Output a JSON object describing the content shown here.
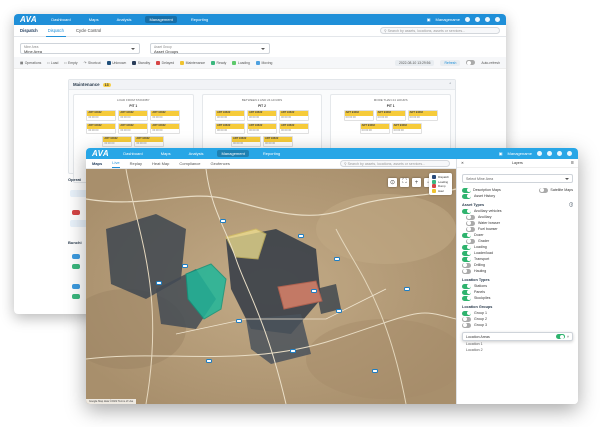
{
  "brand": "AVA",
  "back": {
    "nav": [
      "Dashboard",
      "Maps",
      "Analysis",
      "Management",
      "Reporting"
    ],
    "nav_active": 3,
    "user": "Managename",
    "page": "Dispatch",
    "tabs": [
      "Dispatch",
      "Cycle Control"
    ],
    "search_placeholder": "Search by assets, locations, assets or services...",
    "sel1": {
      "label": "Mine Area",
      "value": "Mine Area"
    },
    "sel2": {
      "label": "Asset Group",
      "value": "Asset Groups"
    },
    "legend_left": [
      "Operations",
      "Load",
      "Empty",
      "Shortcut"
    ],
    "legend_items": [
      {
        "label": "Unknown",
        "color": "#1f4f7a"
      },
      {
        "label": "Standby",
        "color": "#2a3d5a"
      },
      {
        "label": "Delayed",
        "color": "#d64545"
      },
      {
        "label": "Maintenance",
        "color": "#f0c330"
      },
      {
        "label": "Ready",
        "color": "#3bb77e"
      },
      {
        "label": "Loading",
        "color": "#5ec96b"
      },
      {
        "label": "Moving",
        "color": "#4ea1e0"
      }
    ],
    "date": "2022-08-10 13:29:56",
    "refresh": "Refresh",
    "auto_toggle": "Auto-refresh",
    "maint_title": "Maintenance",
    "maint_count": "13",
    "columns": [
      {
        "title": "LOAD FROM STANDBY",
        "pit": "PIT 1",
        "chips": [
          {
            "id": "ART 94632",
            "time": "00:00:00"
          },
          {
            "id": "ART 94632",
            "time": "00:00:00"
          },
          {
            "id": "ART 94632",
            "time": "00:00:00"
          },
          {
            "id": "ART 94632",
            "time": "00:00:00"
          },
          {
            "id": "ART 94632",
            "time": "00:00:00"
          },
          {
            "id": "ART 94632",
            "time": "00:00:00"
          },
          {
            "id": "ART 94632",
            "time": "00:00:00"
          },
          {
            "id": "ART 94632",
            "time": "00:00:00"
          }
        ],
        "pit2": "PIT 1",
        "chips2": [
          {
            "id": "ART 94632",
            "time": "00:00:00"
          },
          {
            "id": "ART 94632",
            "time": "00:00:00"
          },
          {
            "id": "ART 94632",
            "time": "00:00:00"
          },
          {
            "id": "ART 94632",
            "time": "00:00:00"
          }
        ]
      },
      {
        "title": "BETWEEN 2 AND 24 HOURS",
        "pit": "PIT 2",
        "chips": [
          {
            "id": "ART 94632",
            "time": "00:00:00"
          },
          {
            "id": "ART 94632",
            "time": "00:00:00"
          },
          {
            "id": "ART 94632",
            "time": "00:00:00"
          },
          {
            "id": "ART 94632",
            "time": "00:00:00"
          },
          {
            "id": "ART 94632",
            "time": "00:00:00"
          },
          {
            "id": "ART 94632",
            "time": "00:00:00"
          },
          {
            "id": "ART 94632",
            "time": "00:00:00"
          },
          {
            "id": "ART 94632",
            "time": "00:00:00"
          }
        ]
      },
      {
        "title": "MORE THAN 24 HOURS",
        "pit": "PIT 1",
        "chips": [
          {
            "id": "ART 94632",
            "time": "00:00:00"
          },
          {
            "id": "ART 94632",
            "time": "00:00:00"
          },
          {
            "id": "ART 94632",
            "time": "00:00:00"
          },
          {
            "id": "ART 94632",
            "time": "00:00:00"
          },
          {
            "id": "ART 94632",
            "time": "00:00:00"
          }
        ]
      }
    ],
    "left_sections": [
      "Operat",
      "Bunchi"
    ]
  },
  "front": {
    "nav": [
      "Dashboard",
      "Maps",
      "Analysis",
      "Management",
      "Reporting"
    ],
    "nav_active": 3,
    "user": "Managename",
    "tabs": [
      "Maps",
      "Live",
      "Replay",
      "Heat Map",
      "Compliance",
      "Geofences"
    ],
    "tabs_active": 1,
    "search_placeholder": "Search by assets, locations, assets or services...",
    "map_legend": [
      {
        "label": "Dispatch",
        "color": "#2a4a7a"
      },
      {
        "label": "Loading",
        "color": "#3bb77e"
      },
      {
        "label": "Dump",
        "color": "#d64545"
      },
      {
        "label": "Haul",
        "color": "#f0c330"
      }
    ],
    "map_footer": "Google  Map data ©2022  Terms of Use",
    "panel": {
      "title": "Layers",
      "area_placeholder": "Select Mine Area",
      "desc_toggle": "Description Maps",
      "satellite_toggle": "Satellite Maps",
      "asset_history": "Asset History",
      "asset_types_title": "Asset Types",
      "asset_types": [
        {
          "label": "Ancillary vehicles",
          "on": true,
          "sub": false
        },
        {
          "label": "Ancillary",
          "on": false,
          "sub": true
        },
        {
          "label": "Water bowser",
          "on": false,
          "sub": true
        },
        {
          "label": "Fuel bowser",
          "on": false,
          "sub": true
        },
        {
          "label": "Dozer",
          "on": true,
          "sub": false
        },
        {
          "label": "Grader",
          "on": false,
          "sub": true
        },
        {
          "label": "Loading",
          "on": true,
          "sub": false
        },
        {
          "label": "Loader/load",
          "on": true,
          "sub": false
        },
        {
          "label": "Transport",
          "on": true,
          "sub": false
        },
        {
          "label": "Drilling",
          "on": false,
          "sub": false
        },
        {
          "label": "Hauling",
          "on": false,
          "sub": false
        }
      ],
      "location_types_title": "Location Types",
      "location_types": [
        {
          "label": "Stations",
          "on": true
        },
        {
          "label": "Panels",
          "on": true
        },
        {
          "label": "Stockpiles",
          "on": true
        }
      ],
      "location_groups_title": "Location Groups",
      "location_groups": [
        {
          "label": "Group 1",
          "on": true
        },
        {
          "label": "Group 2",
          "on": false
        },
        {
          "label": "Group 3",
          "on": false
        }
      ],
      "location_areas": "Location Areas",
      "location_items": [
        "Location 1",
        "Location 2"
      ]
    }
  }
}
